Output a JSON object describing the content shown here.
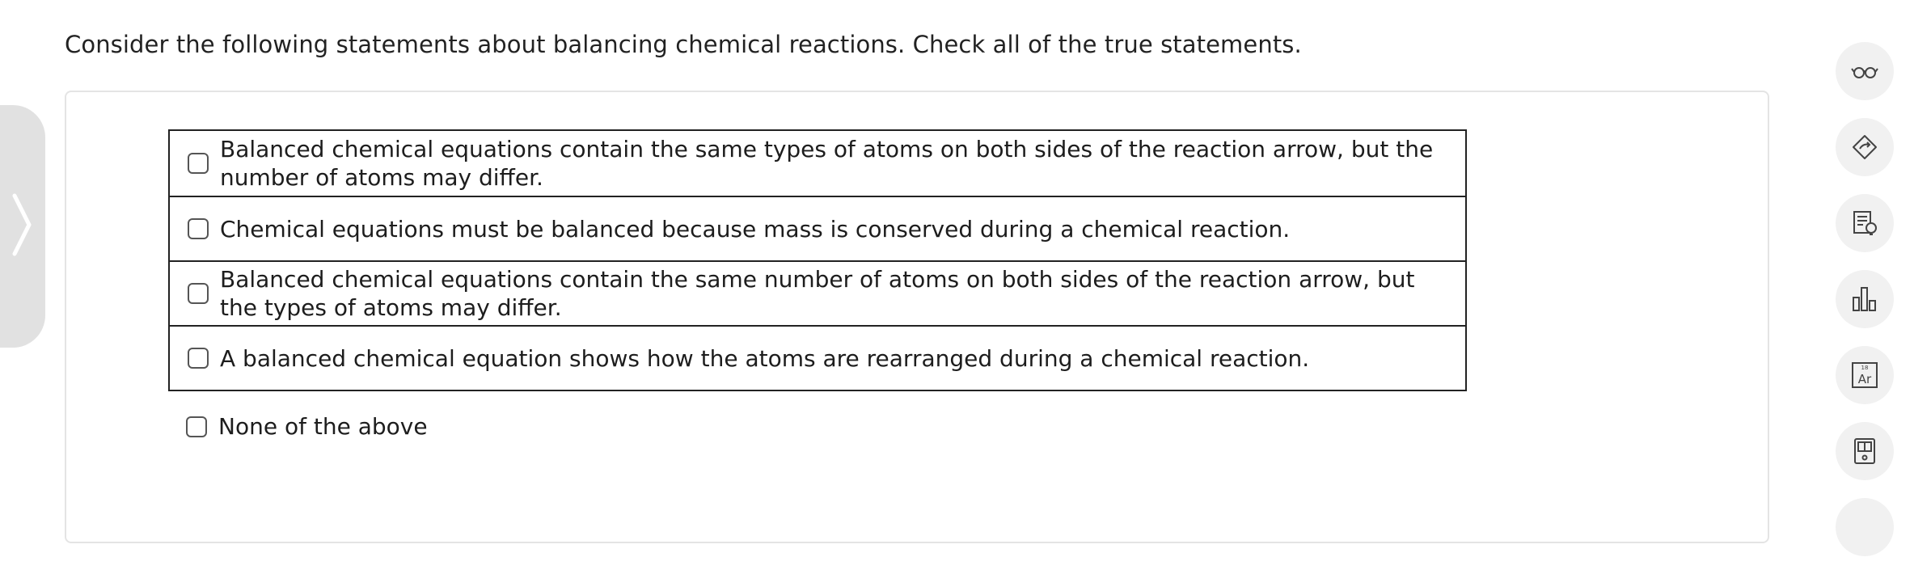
{
  "prompt": "Consider the following statements about balancing chemical reactions. Check all of the true statements.",
  "options": [
    "Balanced chemical equations contain the same types of atoms on both sides of the reaction arrow, but the number of atoms may differ.",
    "Chemical equations must be balanced because mass is conserved during a chemical reaction.",
    "Balanced chemical equations contain the same number of atoms on both sides of the reaction arrow, but the types of atoms may differ.",
    "A balanced chemical equation shows how the atoms are rearranged during a chemical reaction."
  ],
  "none_option": "None of the above",
  "periodic_tile": {
    "number": "18",
    "symbol": "Ar"
  },
  "colors": {
    "border": "#222222",
    "tool_bg": "#f1f1f1",
    "handle": "#e1e1e1"
  }
}
